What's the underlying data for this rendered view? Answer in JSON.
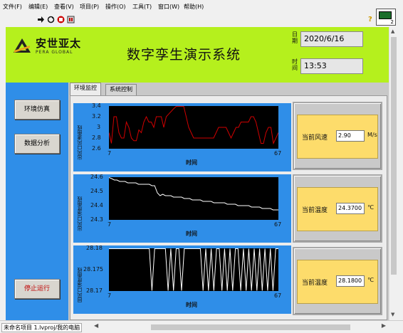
{
  "menu": [
    "文件(F)",
    "编辑(E)",
    "查看(V)",
    "项目(P)",
    "操作(O)",
    "工具(T)",
    "窗口(W)",
    "帮助(H)"
  ],
  "toolbar": {
    "icons": [
      "run-arrow-icon",
      "run-continuous-icon",
      "abort-icon",
      "pause-icon"
    ],
    "help": "?",
    "corner_num": "2"
  },
  "header": {
    "logo_text": "安世亚太",
    "logo_sub": "PERA GLOBAL",
    "title": "数字孪生演示系统",
    "date_label": "日期",
    "date_value": "2020/6/16",
    "time_label": "时间",
    "time_value": "13:53"
  },
  "nav": {
    "sim": "环境仿真",
    "analysis": "数据分析",
    "stop": "停止运行"
  },
  "tabs": [
    "环境监控",
    "系统控制"
  ],
  "charts": [
    {
      "ylabel": "出风口风速曲线",
      "xlabel": "时间",
      "yticks": [
        "3.4",
        "3.2",
        "3",
        "2.8",
        "2.6"
      ],
      "xmin": "7",
      "xmax": "67",
      "color": "#d00000"
    },
    {
      "ylabel": "出风口温度曲线",
      "xlabel": "时间",
      "yticks": [
        "24.6",
        "24.5",
        "24.4",
        "24.3"
      ],
      "xmin": "7",
      "xmax": "67",
      "color": "#ffffff"
    },
    {
      "ylabel": "回风口温度曲线",
      "xlabel": "时间",
      "yticks": [
        "28.18",
        "28.175",
        "28.17"
      ],
      "xmin": "7",
      "xmax": "67",
      "color": "#ffffff"
    }
  ],
  "readouts": [
    {
      "label": "当前风速",
      "value": "2.90",
      "unit": "M/s"
    },
    {
      "label": "当前温度",
      "value": "24.3700",
      "unit": "℃"
    },
    {
      "label": "当前温度",
      "value": "28.1800",
      "unit": "℃"
    }
  ],
  "chart_data": [
    {
      "type": "line",
      "ylabel": "出风口风速曲线",
      "xlabel": "时间",
      "xlim": [
        7,
        67
      ],
      "ylim": [
        2.6,
        3.4
      ],
      "series": [
        {
          "values": [
            2.9,
            2.7,
            3.2,
            3.2,
            2.9,
            2.8,
            2.8,
            3.1,
            3.0,
            2.8,
            2.75,
            2.75,
            2.95,
            2.9,
            3.1,
            3.2,
            3.1,
            3.1,
            3.0,
            3.2,
            3.2,
            3.2,
            3.0,
            3.2,
            3.25,
            3.3,
            3.35,
            3.4,
            3.4,
            3.4,
            3.4,
            3.2,
            3.0,
            2.9,
            2.8,
            2.8,
            2.8,
            2.8,
            2.8,
            2.8,
            2.8,
            2.8,
            2.8,
            2.9,
            3.0,
            3.0,
            3.0,
            3.0,
            2.9,
            2.8,
            2.9,
            3.0,
            3.0,
            3.1,
            3.1,
            3.1,
            3.1,
            3.2,
            3.2,
            3.1,
            2.9,
            2.7,
            2.7,
            2.9,
            3.0,
            3.0,
            2.7,
            2.8,
            2.9
          ]
        }
      ]
    },
    {
      "type": "line",
      "ylabel": "出风口温度曲线",
      "xlabel": "时间",
      "xlim": [
        7,
        67
      ],
      "ylim": [
        24.3,
        24.6
      ],
      "series": [
        {
          "values": [
            24.6,
            24.59,
            24.58,
            24.58,
            24.57,
            24.57,
            24.57,
            24.56,
            24.56,
            24.56,
            24.56,
            24.55,
            24.55,
            24.55,
            24.55,
            24.55,
            24.54,
            24.54,
            24.49,
            24.47,
            24.48,
            24.47,
            24.47,
            24.47,
            24.46,
            24.46,
            24.46,
            24.46,
            24.45,
            24.45,
            24.45,
            24.44,
            24.44,
            24.44,
            24.44,
            24.43,
            24.43,
            24.43,
            24.43,
            24.42,
            24.42,
            24.42,
            24.42,
            24.42,
            24.41,
            24.41,
            24.41,
            24.41,
            24.4,
            24.4,
            24.4,
            24.4,
            24.4,
            24.39,
            24.39,
            24.39,
            24.39,
            24.38,
            24.38,
            24.38,
            24.38,
            24.37,
            24.37,
            24.37
          ]
        }
      ]
    },
    {
      "type": "line",
      "ylabel": "回风口温度曲线",
      "xlabel": "时间",
      "xlim": [
        7,
        67
      ],
      "ylim": [
        28.17,
        28.18
      ],
      "series": [
        {
          "values": [
            28.18,
            28.18,
            28.18,
            28.18,
            28.18,
            28.18,
            28.18,
            28.18,
            28.18,
            28.18,
            28.18,
            28.18,
            28.18,
            28.18,
            28.18,
            28.18,
            28.17,
            28.18,
            28.18,
            28.18,
            28.18,
            28.18,
            28.17,
            28.18,
            28.17,
            28.18,
            28.18,
            28.17,
            28.18,
            28.18,
            28.18,
            28.18,
            28.18,
            28.18,
            28.18,
            28.17,
            28.18,
            28.17,
            28.18,
            28.17,
            28.18,
            28.18,
            28.17,
            28.18,
            28.17,
            28.18,
            28.17,
            28.18,
            28.18,
            28.17,
            28.18,
            28.17,
            28.18,
            28.17,
            28.18,
            28.17,
            28.18,
            28.17,
            28.18,
            28.17,
            28.18,
            28.17,
            28.18,
            28.18
          ]
        }
      ]
    }
  ],
  "status": {
    "path": "未命名项目 1.lvproj/我的电脑"
  }
}
